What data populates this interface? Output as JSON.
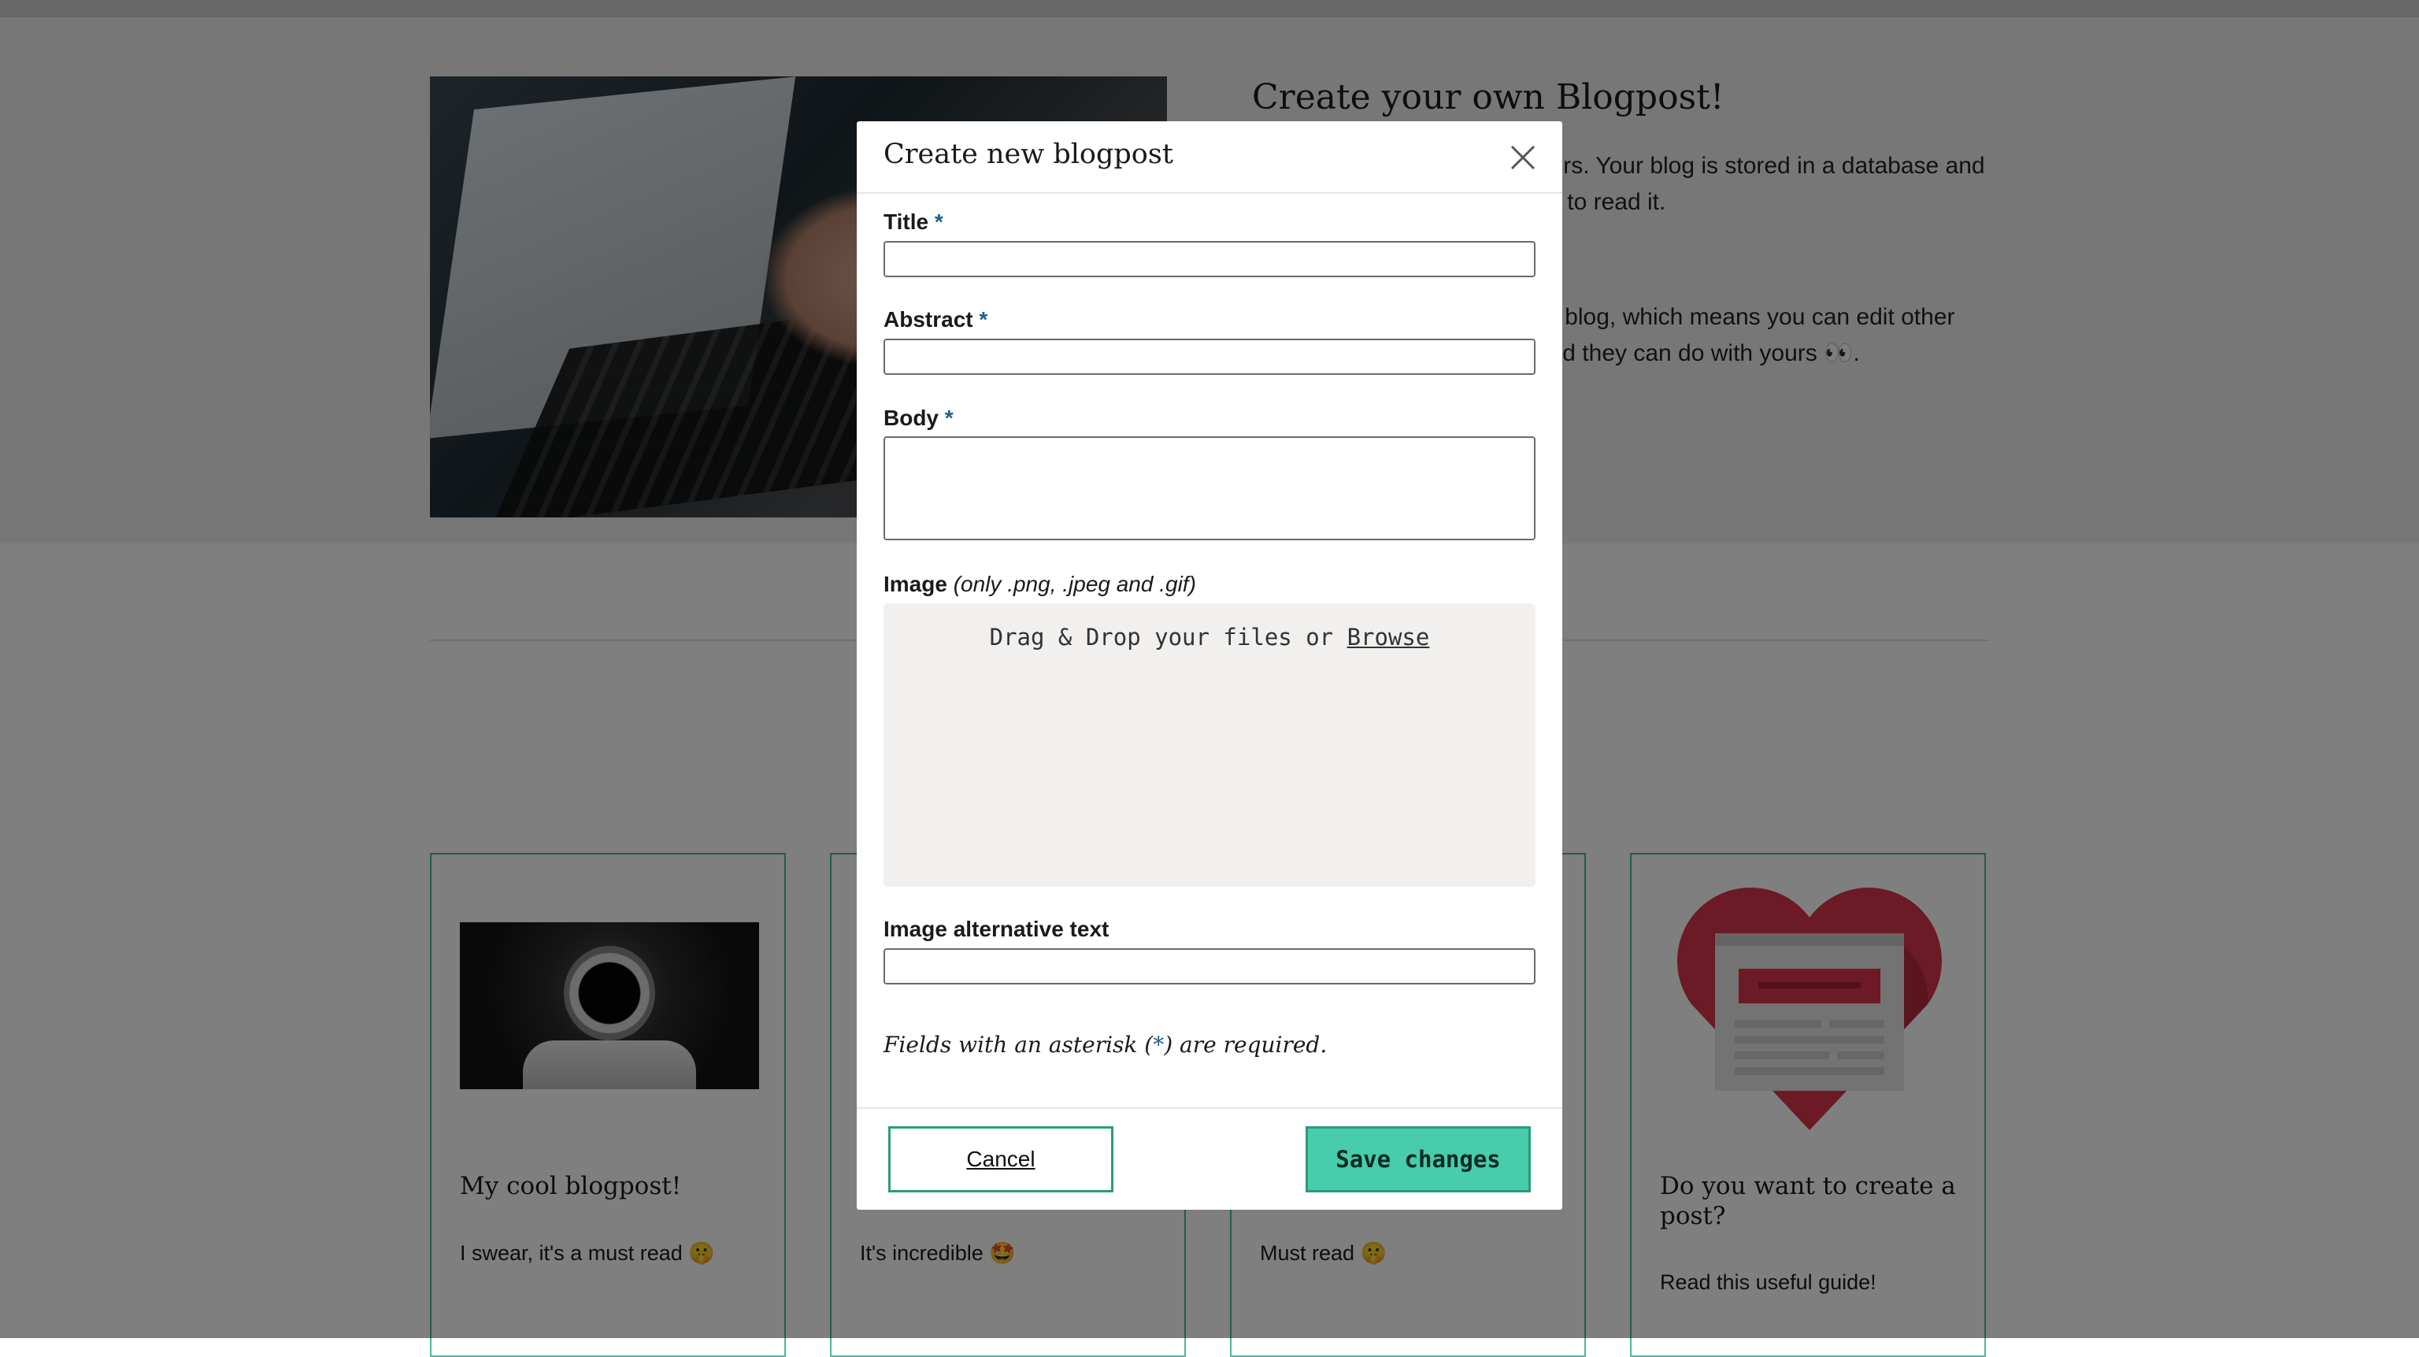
{
  "hero": {
    "title": "Create your own Blogpost!",
    "paragraph1": "Share your opinions with others. Your blog is stored in a database and every user is going to be able to read it.",
    "paragraph2": "It's a \"free for all\" anonymous blog, which means you can edit other users' blogs if you want to, and they can do with yours 👀."
  },
  "cards": [
    {
      "title": "My cool blogpost!",
      "text": "I swear, it's a must read 🤫"
    },
    {
      "title": "",
      "text": "It's incredible 🤩"
    },
    {
      "title": "",
      "text": "Must read 🤫"
    },
    {
      "title": "Do you want to create a post?",
      "text": "Read this useful guide!"
    }
  ],
  "modal": {
    "title": "Create new blogpost",
    "close_icon": "close-icon",
    "fields": {
      "title_label": "Title",
      "title_value": "",
      "abstract_label": "Abstract",
      "abstract_value": "",
      "body_label": "Body",
      "body_value": "",
      "image_label": "Image",
      "image_hint": "(only .png, .jpeg and .gif)",
      "alt_label": "Image alternative text",
      "alt_value": "",
      "required_marker": "*"
    },
    "dropzone": {
      "text": "Drag & Drop your files or",
      "browse": "Browse"
    },
    "note_before": "Fields with an asterisk (",
    "note_marker": "*",
    "note_after": ") are required.",
    "cancel_label": "Cancel",
    "save_label": "Save changes"
  },
  "colors": {
    "accent": "#47ccac",
    "accent_border": "#2a9d7e",
    "required": "#1f5f8b",
    "overlay": "rgba(0,0,0,0.5)"
  }
}
